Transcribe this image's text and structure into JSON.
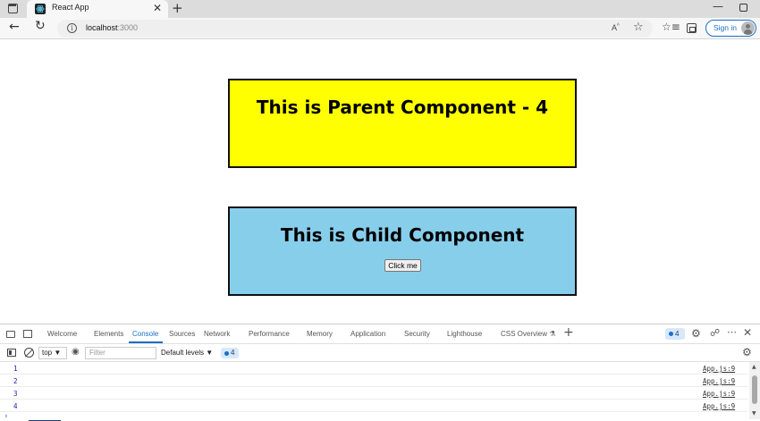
{
  "browser": {
    "tab_title": "React App",
    "tab_close": "✕",
    "new_tab": "+",
    "minimize": "—",
    "back": "←",
    "reload": "↻",
    "url_host": "localhost",
    "url_port": ":3000",
    "read_aloud": "A͂ᴬ",
    "signin_label": "Sign in"
  },
  "page": {
    "parent_title": "This is Parent Component - 4",
    "child_title": "This is Child Component",
    "click_button": "Click me"
  },
  "devtools": {
    "tabs": [
      "Welcome",
      "Elements",
      "Console",
      "Sources",
      "Network",
      "Performance",
      "Memory",
      "Application",
      "Security",
      "Lighthouse",
      "CSS Overview ⚗"
    ],
    "active_tab": "Console",
    "issues_count": "4",
    "filterbar": {
      "context": "top ▼",
      "filter_placeholder": "Filter",
      "levels": "Default levels ▼",
      "message_count": "4"
    },
    "logs": [
      {
        "value": "1",
        "source": "App.js:9"
      },
      {
        "value": "2",
        "source": "App.js:9"
      },
      {
        "value": "3",
        "source": "App.js:9"
      },
      {
        "value": "4",
        "source": "App.js:9"
      }
    ],
    "prompt": "›"
  },
  "colors": {
    "parent_bg": "#ffff00",
    "child_bg": "#87ceeb",
    "accent": "#1a6fc4"
  }
}
